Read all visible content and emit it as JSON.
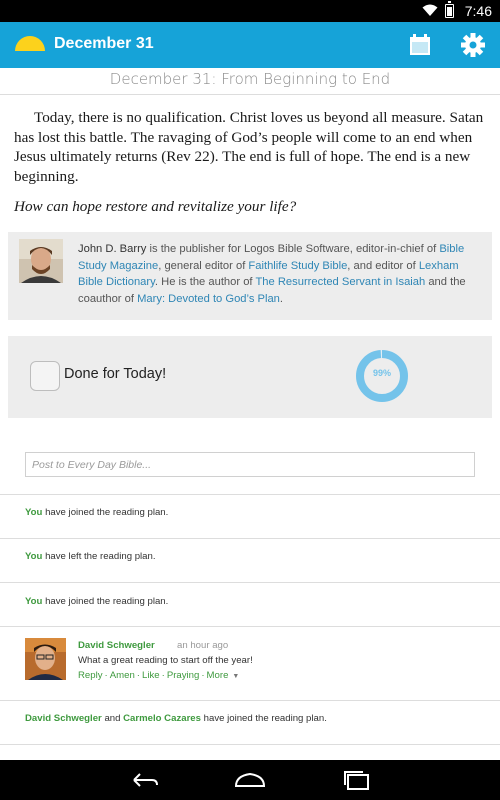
{
  "status_bar": {
    "time": "7:46",
    "icons": [
      "wifi-icon",
      "battery-charging-icon"
    ]
  },
  "app_bar": {
    "title": "December 31",
    "icons": [
      "sunrise-logo-icon",
      "calendar-icon",
      "gear-icon"
    ],
    "color": "#16a3d8"
  },
  "day": {
    "title": "December 31: From Beginning to End",
    "reading": "Today, there is no qualification. Christ loves us beyond all measure. Satan has lost this battle. The ravaging of God’s people will come to an end when Jesus ultimately returns (Rev 22). The end is full of hope. The end is a new beginning.",
    "question": "How can hope restore and revitalize your life?"
  },
  "author": {
    "name": "John D. Barry",
    "t1": " is the publisher for Logos Bible Software, editor-in-chief of ",
    "link1": "Bible Study Magazine",
    "t2": ", general editor of ",
    "link2": "Faithlife Study Bible",
    "t3": ", and editor of ",
    "link3": "Lexham Bible Dictionary",
    "t4": ". He is the author of ",
    "link4": "The Resurrected Servant in Isaiah",
    "t5": " and the coauthor of ",
    "link5": "Mary: Devoted to God’s Plan",
    "t6": "."
  },
  "done": {
    "label": "Done for Today!",
    "checked": false,
    "progress_text": "99%",
    "progress": 0.99
  },
  "post": {
    "placeholder": "Post to Every Day Bible..."
  },
  "feed": [
    {
      "who": "You",
      "text": " have joined the reading plan."
    },
    {
      "who": "You",
      "text": " have left the reading plan."
    },
    {
      "who": "You",
      "text": " have joined the reading plan."
    }
  ],
  "comment": {
    "name": "David Schwegler",
    "time": "an hour ago",
    "text": "What a great reading to start off the year!",
    "actions": [
      "Reply",
      "Amen",
      "Like",
      "Praying",
      "More"
    ]
  },
  "joined": {
    "name1": "David Schwegler",
    "and": " and ",
    "name2": "Carmelo Cazares",
    "text": " have joined the reading plan."
  },
  "nav_bar": {
    "icons": [
      "back-icon",
      "home-icon",
      "recents-icon"
    ]
  },
  "colors": {
    "accent": "#16a3d8",
    "link": "#2f86b5",
    "user_green": "#3f9a3f",
    "progress": "#74c3ea"
  }
}
